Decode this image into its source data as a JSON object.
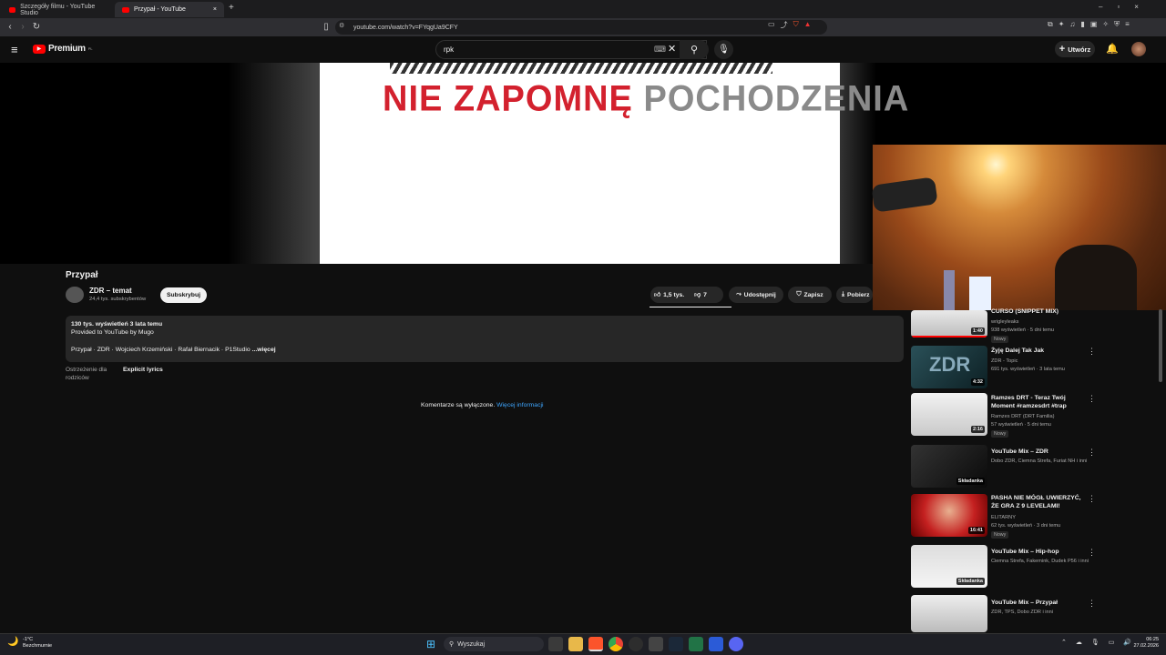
{
  "browser": {
    "tabs": [
      {
        "label": "Szczegóły filmu - YouTube Studio"
      },
      {
        "label": "Przypał - YouTube"
      }
    ],
    "new_tab": "+",
    "url": "youtube.com/watch?v=FYqgUa9CFY",
    "window_controls": [
      "–",
      "▫",
      "×"
    ]
  },
  "yt_header": {
    "logo": "Premium",
    "logo_sup": "PL",
    "search_value": "rpk",
    "create_label": "Utwórz"
  },
  "video": {
    "overlay_title_red": "NIE ZAPOMNĘ",
    "overlay_title_gray": "POCHODZENIA",
    "title": "Przypał",
    "channel_name": "ZDR – temat",
    "subscribers": "24,4 tys. subskrybentów",
    "subscribe_label": "Subskrybuj",
    "likes": "1,5 tys.",
    "dislikes": "7",
    "share_label": "Udostępnij",
    "save_label": "Zapisz",
    "download_label": "Pobierz"
  },
  "description": {
    "stats": "130 tys. wyświetleń  3 lata temu",
    "provided": "Provided to YouTube by Mugo",
    "credits": "Przypał · ZDR · Wojciech Krzemiński · Rafał Biernacik · P1Studio",
    "more": "...więcej"
  },
  "parental": {
    "label": "Ostrzeżenie dla rodziców",
    "value": "Explicit lyrics"
  },
  "comments": {
    "text": "Komentarze są wyłączone.",
    "link": "Więcej informacji"
  },
  "sidebar": [
    {
      "title": "CURSO (SNIPPET MIX)",
      "channel": "wrigleyleaks",
      "meta": "938 wyświetleń · 5 dni temu",
      "badge": "Nowy",
      "duration": "1:40"
    },
    {
      "title": "Żyję Dalej Tak Jak",
      "channel": "ZDR - Topic",
      "meta": "691 tys. wyświetleń · 3 lata temu",
      "badge": "",
      "duration": "4:32"
    },
    {
      "title": "Ramzes DRT - Teraz Twój Moment #ramzesdrt #trap",
      "channel": "Ramzes DRT (DRT Familia)",
      "meta": "57 wyświetleń · 5 dni temu",
      "badge": "Nowy",
      "duration": "2:16"
    },
    {
      "title": "YouTube Mix – ZDR",
      "channel": "Dobo ZDR, Ciemna Strefa, Furiat NH i inni",
      "meta": "",
      "badge": "",
      "duration": "Składanka"
    },
    {
      "title": "PASHA NIE MÓGŁ UWIERZYĆ, ŻE GRA Z 9 LEVELAMI!",
      "channel": "ELITARNY",
      "meta": "62 tys. wyświetleń · 3 dni temu",
      "badge": "Nowy",
      "duration": "16:41"
    },
    {
      "title": "YouTube Mix – Hip-hop",
      "channel": "Ciemna Strefa, Fakemink, Dudek P56 i inni",
      "meta": "",
      "badge": "",
      "duration": "Składanka"
    },
    {
      "title": "YouTube Mix – Przypał",
      "channel": "ZDR, TPS, Dobo ZDR i inni",
      "meta": "",
      "badge": "",
      "duration": ""
    }
  ],
  "taskbar": {
    "weather_temp": "-1°C",
    "weather_desc": "Bezchmurnie",
    "search_placeholder": "Wyszukaj",
    "time": "06:25",
    "date": "27.02.2026"
  }
}
